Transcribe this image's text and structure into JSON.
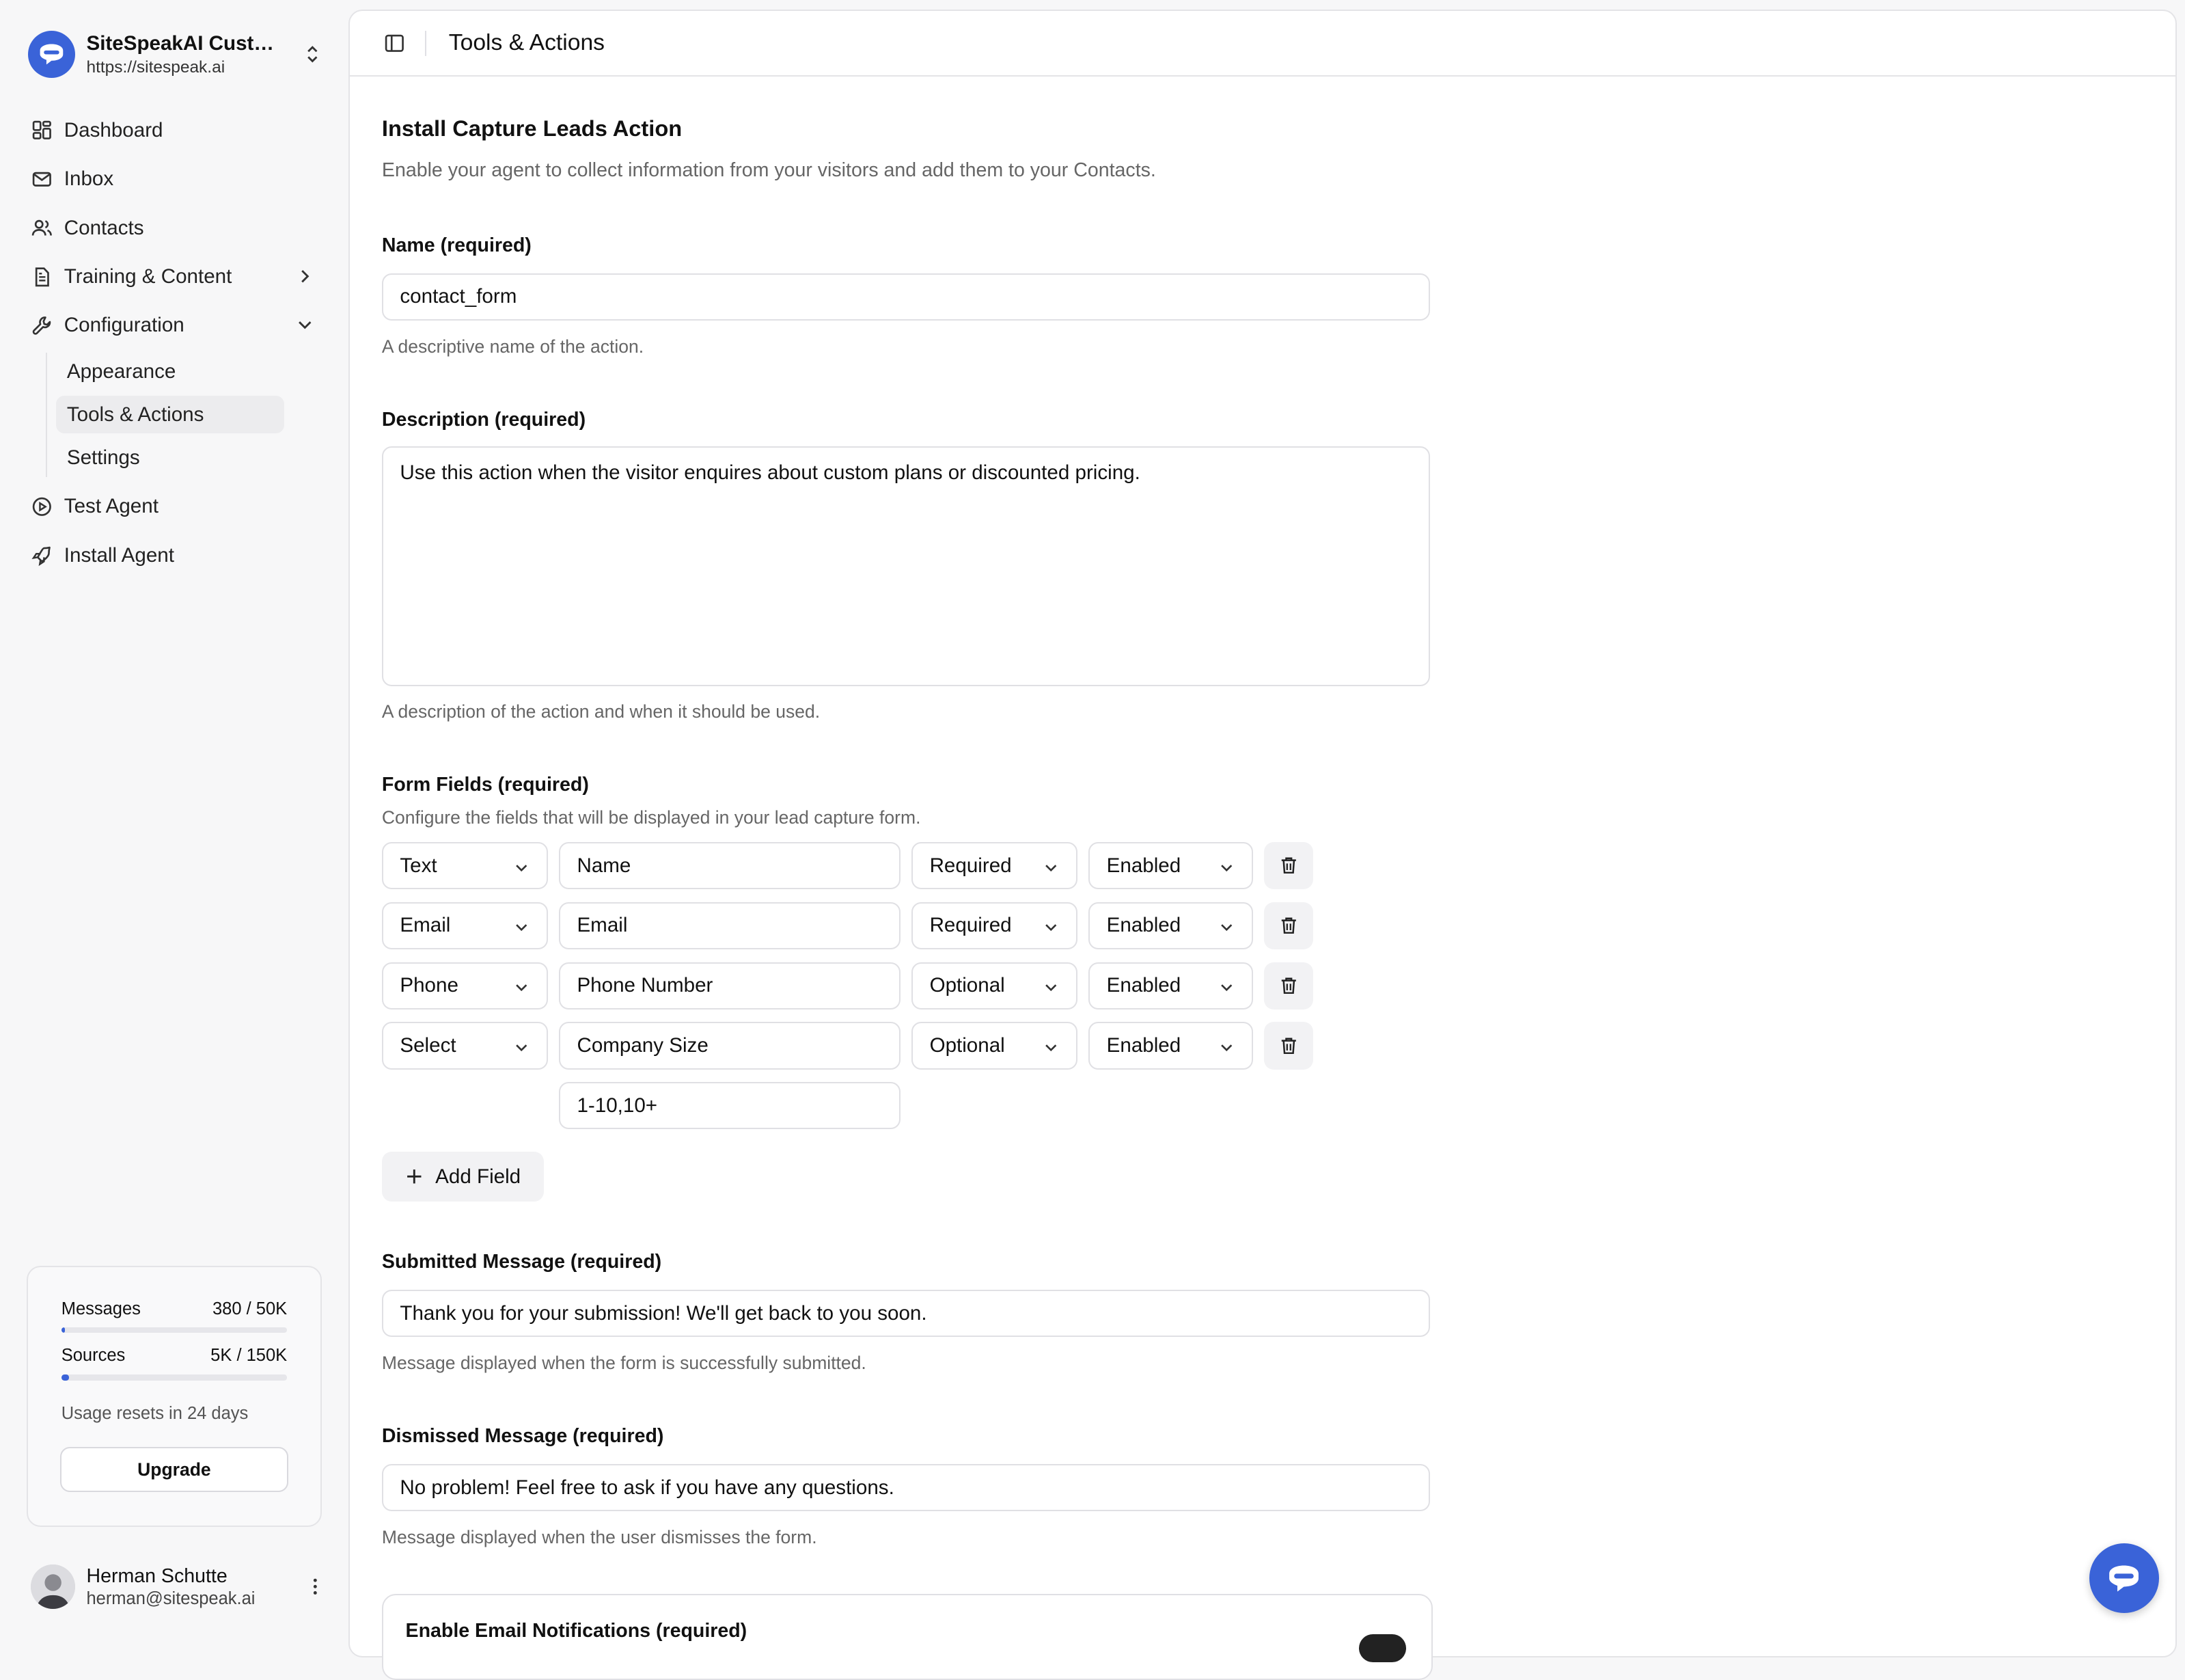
{
  "workspace": {
    "name": "SiteSpeakAI Custo...",
    "url": "https://sitespeak.ai"
  },
  "nav": {
    "dashboard": "Dashboard",
    "inbox": "Inbox",
    "contacts": "Contacts",
    "training": "Training & Content",
    "configuration": "Configuration",
    "sub": {
      "appearance": "Appearance",
      "tools": "Tools & Actions",
      "settings": "Settings"
    },
    "test_agent": "Test Agent",
    "install_agent": "Install Agent"
  },
  "usage": {
    "messages_label": "Messages",
    "messages_value": "380 / 50K",
    "messages_progress": 0.0076,
    "sources_label": "Sources",
    "sources_value": "5K / 150K",
    "sources_progress": 0.033,
    "reset_text": "Usage resets in 24 days",
    "upgrade_label": "Upgrade"
  },
  "user": {
    "name": "Herman Schutte",
    "email": "herman@sitespeak.ai"
  },
  "topbar": {
    "title": "Tools & Actions"
  },
  "page": {
    "title": "Install Capture Leads Action",
    "subtitle": "Enable your agent to collect information from your visitors and add them to your Contacts.",
    "name_label": "Name (required)",
    "name_value": "contact_form",
    "name_hint": "A descriptive name of the action.",
    "desc_label": "Description (required)",
    "desc_value": "Use this action when the visitor enquires about custom plans or discounted pricing.",
    "desc_hint": "A description of the action and when it should be used.",
    "fields_label": "Form Fields (required)",
    "fields_hint": "Configure the fields that will be displayed in your lead capture form.",
    "fields": [
      {
        "type": "Text",
        "label": "Name",
        "required": "Required",
        "status": "Enabled"
      },
      {
        "type": "Email",
        "label": "Email",
        "required": "Required",
        "status": "Enabled"
      },
      {
        "type": "Phone",
        "label": "Phone Number",
        "required": "Optional",
        "status": "Enabled"
      },
      {
        "type": "Select",
        "label": "Company Size",
        "required": "Optional",
        "status": "Enabled"
      }
    ],
    "select_options_value": "1-10,10+",
    "add_field_label": "Add Field",
    "submitted_label": "Submitted Message (required)",
    "submitted_value": "Thank you for your submission! We'll get back to you soon.",
    "submitted_hint": "Message displayed when the form is successfully submitted.",
    "dismissed_label": "Dismissed Message (required)",
    "dismissed_value": "No problem! Feel free to ask if you have any questions.",
    "dismissed_hint": "Message displayed when the user dismisses the form.",
    "email_notifications_label": "Enable Email Notifications (required)"
  },
  "colors": {
    "accent": "#3a63d8",
    "sidebar_bg": "#f7f7f8",
    "border": "#e4e4e7"
  }
}
